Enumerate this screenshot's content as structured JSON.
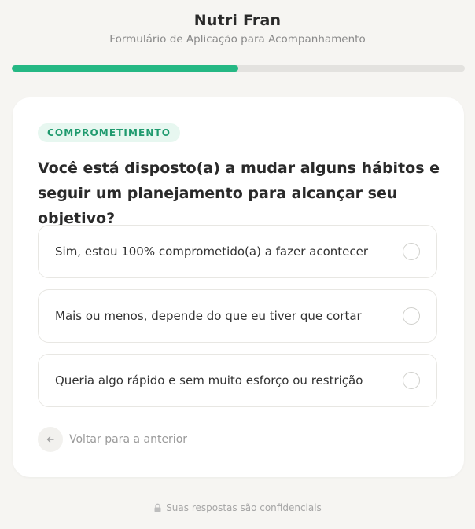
{
  "header": {
    "brand": "Nutri Fran",
    "subtitle": "Formulário de Aplicação para Acompanhamento"
  },
  "progress": {
    "fraction": 0.5,
    "fill_color": "#25b884"
  },
  "card": {
    "badge": "COMPROMETIMENTO",
    "question": "Você está disposto(a) a mudar alguns hábitos e seguir um planejamento para alcançar seu objetivo?",
    "options": [
      {
        "label": "Sim, estou 100% comprometido(a) a fazer acontecer"
      },
      {
        "label": "Mais ou menos, depende do que eu tiver que cortar"
      },
      {
        "label": "Queria algo rápido e sem muito esforço ou restrição"
      }
    ],
    "back": {
      "icon": "arrow-left-icon",
      "label": "Voltar para a anterior"
    }
  },
  "footer": {
    "icon": "lock-icon",
    "text": "Suas respostas são confidenciais"
  },
  "colors": {
    "accent": "#25b884",
    "badge_bg": "#e7f7f0",
    "badge_text": "#1f9a6e"
  }
}
